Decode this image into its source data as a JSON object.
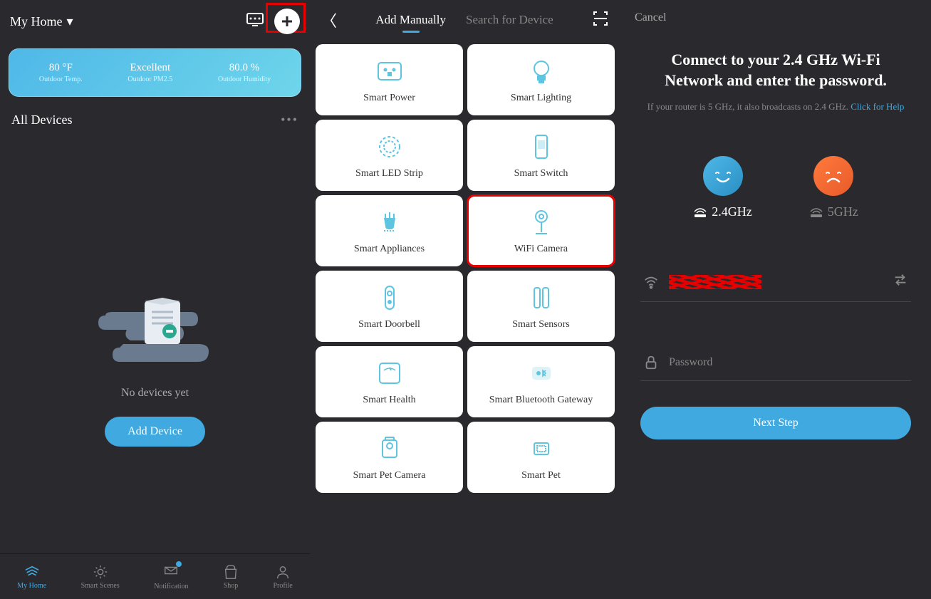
{
  "panel1": {
    "home_label": "My Home",
    "weather": {
      "temp_val": "80 °F",
      "temp_lbl": "Outdoor Temp.",
      "quality_val": "Excellent",
      "quality_lbl": "Outdoor PM2.5",
      "humidity_val": "80.0 %",
      "humidity_lbl": "Outdoor Humidity"
    },
    "all_devices": "All Devices",
    "empty_text": "No devices yet",
    "add_device": "Add Device",
    "nav": {
      "home": "My Home",
      "scenes": "Smart Scenes",
      "notification": "Notification",
      "shop": "Shop",
      "profile": "Profile"
    }
  },
  "panel2": {
    "tab_manual": "Add Manually",
    "tab_search": "Search for Device",
    "devices": [
      "Smart Power",
      "Smart Lighting",
      "Smart LED Strip",
      "Smart Switch",
      "Smart Appliances",
      "WiFi Camera",
      "Smart Doorbell",
      "Smart Sensors",
      "Smart Health",
      "Smart Bluetooth Gateway",
      "Smart Pet Camera",
      "Smart Pet"
    ]
  },
  "panel3": {
    "cancel": "Cancel",
    "title": "Connect to your 2.4 GHz Wi-Fi Network and enter the password.",
    "subtitle_a": "If your router is 5 GHz, it also broadcasts on 2.4 GHz. ",
    "help_link": "Click for Help",
    "freq_24": "2.4GHz",
    "freq_5": "5GHz",
    "password_placeholder": "Password",
    "next": "Next Step"
  }
}
